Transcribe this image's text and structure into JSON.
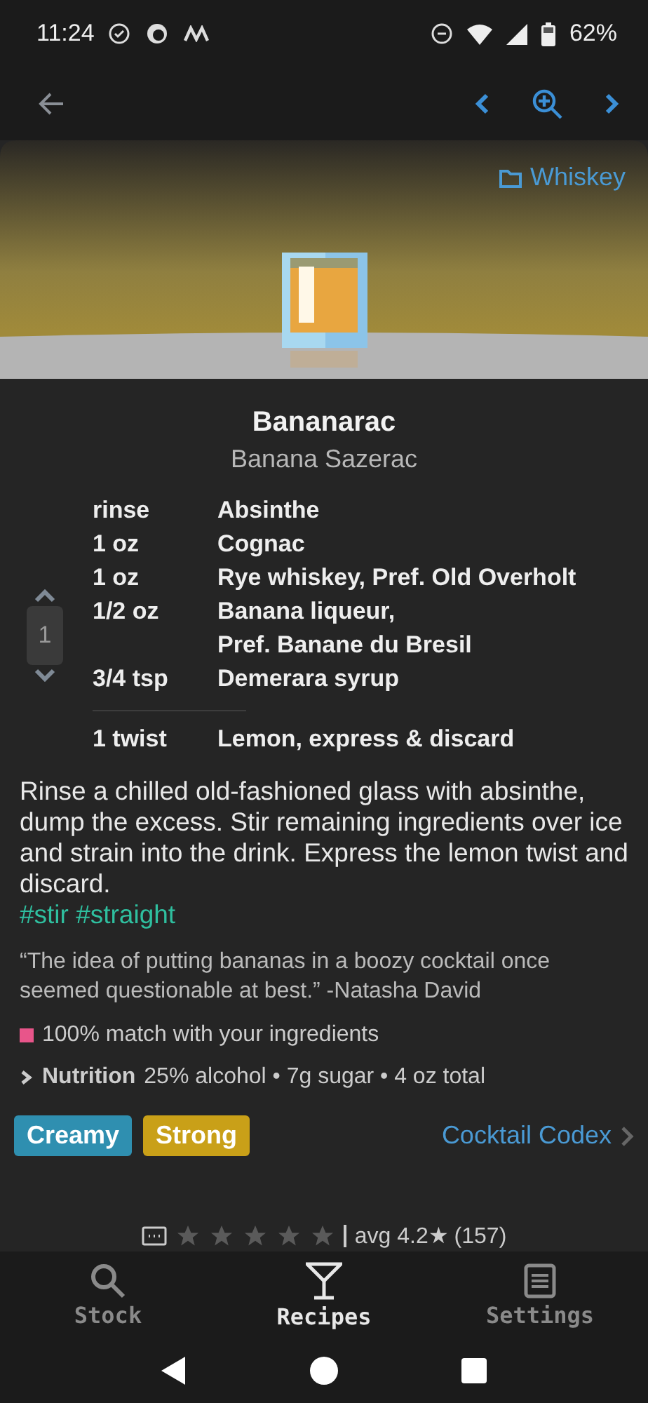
{
  "status_bar": {
    "time": "11:24",
    "battery": "62%"
  },
  "category": "Whiskey",
  "title": "Bananarac",
  "subtitle": "Banana Sazerac",
  "servings": "1",
  "ingredients": [
    {
      "kind": "ingredient",
      "amount": "rinse",
      "name": "Absinthe"
    },
    {
      "kind": "ingredient",
      "amount": "1 oz",
      "name": "Cognac"
    },
    {
      "kind": "ingredient",
      "amount": "1 oz",
      "name": "Rye whiskey, Pref. Old Overholt"
    },
    {
      "kind": "ingredient",
      "amount": "1/2 oz",
      "name": "Banana liqueur,\nPref. Banane du Bresil"
    },
    {
      "kind": "ingredient",
      "amount": "3/4 tsp",
      "name": "Demerara syrup"
    },
    {
      "kind": "garnish",
      "amount": "1 twist",
      "name": "Lemon, express & discard"
    }
  ],
  "instructions": "Rinse a chilled old-fashioned glass with absinthe, dump the excess. Stir remaining ingredients over ice and strain into the drink. Express the lemon twist and discard.",
  "hashtags": "#stir #straight",
  "quote": "“The idea of putting bananas in a boozy cocktail once seemed questionable at best.” -Natasha David",
  "match": {
    "text": "100% match with your ingredients",
    "color": "#e8558a"
  },
  "nutrition": {
    "label": "Nutrition",
    "summary": "25% alcohol • 7g sugar • 4 oz total",
    "expanded": false
  },
  "tags": [
    {
      "label": "Creamy",
      "color": "#2f8fb0"
    },
    {
      "label": "Strong",
      "color": "#c9a018"
    }
  ],
  "source": "Cocktail Codex",
  "rating": {
    "stars": 0,
    "average": "avg 4.2★ (157)"
  },
  "bottom_nav": [
    {
      "label": "Stock",
      "selected": false
    },
    {
      "label": "Recipes",
      "selected": true
    },
    {
      "label": "Settings",
      "selected": false
    }
  ]
}
